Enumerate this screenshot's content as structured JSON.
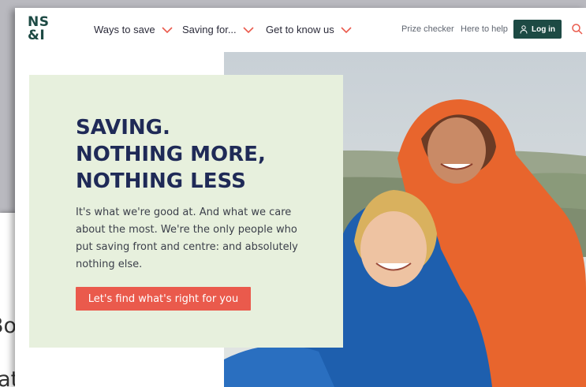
{
  "back_window": {
    "line_1": "Bond)",
    "line_2": "rate)"
  },
  "header": {
    "logo_top": "NS",
    "logo_bottom": "&I",
    "nav": [
      {
        "label": "Ways to save"
      },
      {
        "label": "Saving for..."
      },
      {
        "label": "Get to know us"
      }
    ],
    "prize_checker": "Prize checker",
    "here_to_help": "Here to help",
    "login_label": "Log in"
  },
  "hero": {
    "title_lines": [
      "SAVING.",
      "NOTHING MORE,",
      "NOTHING LESS"
    ],
    "body": "It's what we're good at. And what we care about the most. We're the only people who put saving front and centre: and absolutely nothing else.",
    "cta_label": "Let's find what's right for you"
  },
  "colors": {
    "brand_green": "#1d4a44",
    "hero_card_bg": "#e7f0dd",
    "title_navy": "#1f2a57",
    "cta_coral": "#ea5a4c"
  },
  "icons": [
    "chevron-down-icon",
    "user-icon",
    "search-icon"
  ]
}
